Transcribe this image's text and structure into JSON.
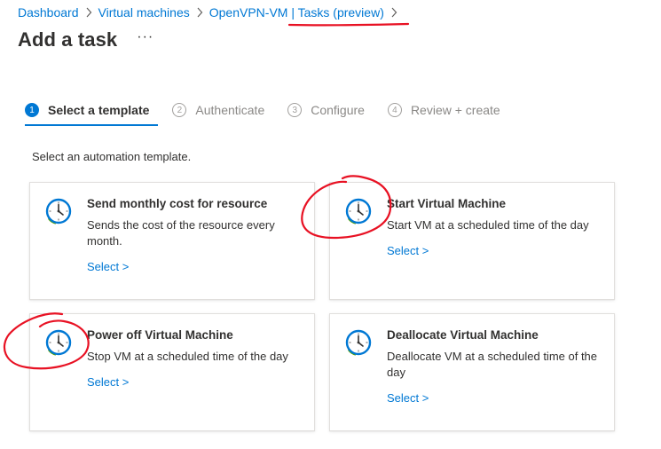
{
  "breadcrumb": {
    "items": [
      "Dashboard",
      "Virtual machines",
      "OpenVPN-VM | Tasks (preview)"
    ]
  },
  "page": {
    "title": "Add a task",
    "more_label": "···"
  },
  "steps": [
    {
      "number": "1",
      "label": "Select a template",
      "active": true
    },
    {
      "number": "2",
      "label": "Authenticate",
      "active": false
    },
    {
      "number": "3",
      "label": "Configure",
      "active": false
    },
    {
      "number": "4",
      "label": "Review + create",
      "active": false
    }
  ],
  "intro": "Select an automation template.",
  "templates": [
    {
      "title": "Send monthly cost for resource",
      "description": "Sends the cost of the resource every month.",
      "link": "Select >"
    },
    {
      "title": "Start Virtual Machine",
      "description": "Start VM at a scheduled time of the day",
      "link": "Select >"
    },
    {
      "title": "Power off Virtual Machine",
      "description": "Stop VM at a scheduled time of the day",
      "link": "Select >"
    },
    {
      "title": "Deallocate Virtual Machine",
      "description": "Deallocate VM at a scheduled time of the day",
      "link": "Select >"
    }
  ],
  "icons": {
    "template_icon": "clock-icon",
    "breadcrumb_separator": "chevron-right-icon"
  },
  "colors": {
    "accent": "#0078d4",
    "annotation": "#e81123",
    "clock_face": "#0078d4",
    "clock_arrow": "#57a300"
  }
}
